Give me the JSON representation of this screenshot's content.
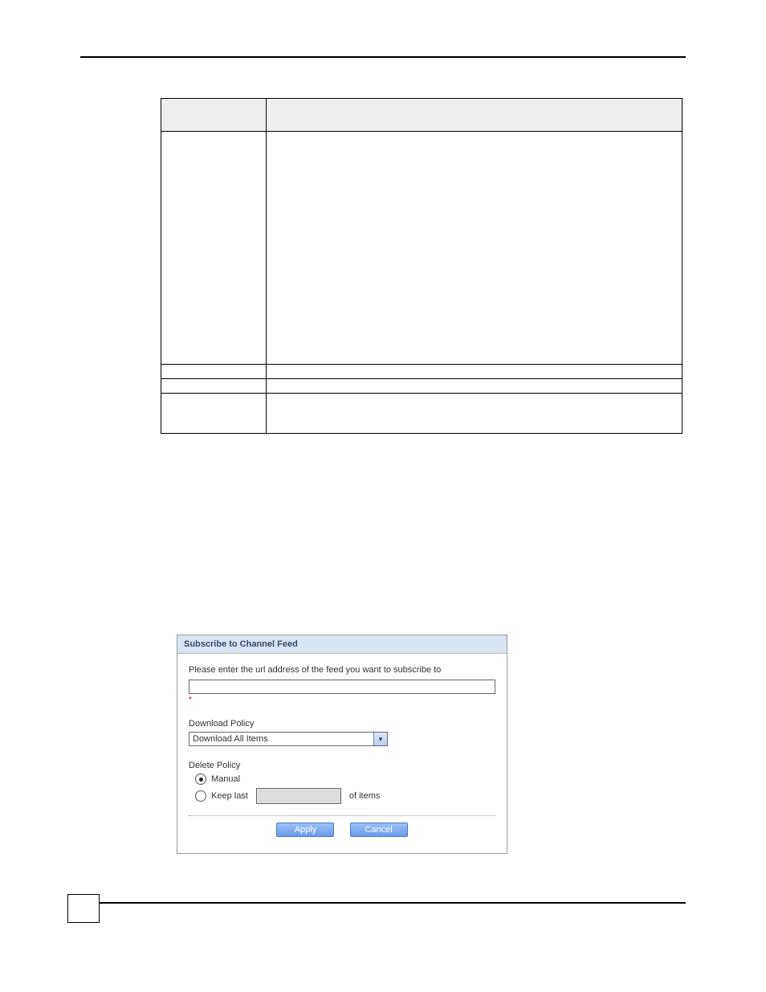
{
  "subscribe": {
    "title": "Subscribe to Channel Feed",
    "instruction": "Please enter the url address of the feed you want to subscribe to",
    "url_value": "",
    "download_label": "Download Policy",
    "download_selected": "Download All Items",
    "delete_label": "Delete Policy",
    "radio_manual": "Manual",
    "radio_keep_prefix": "Keep last",
    "radio_keep_suffix": "of items",
    "apply": "Apply",
    "cancel": "Cancel"
  }
}
